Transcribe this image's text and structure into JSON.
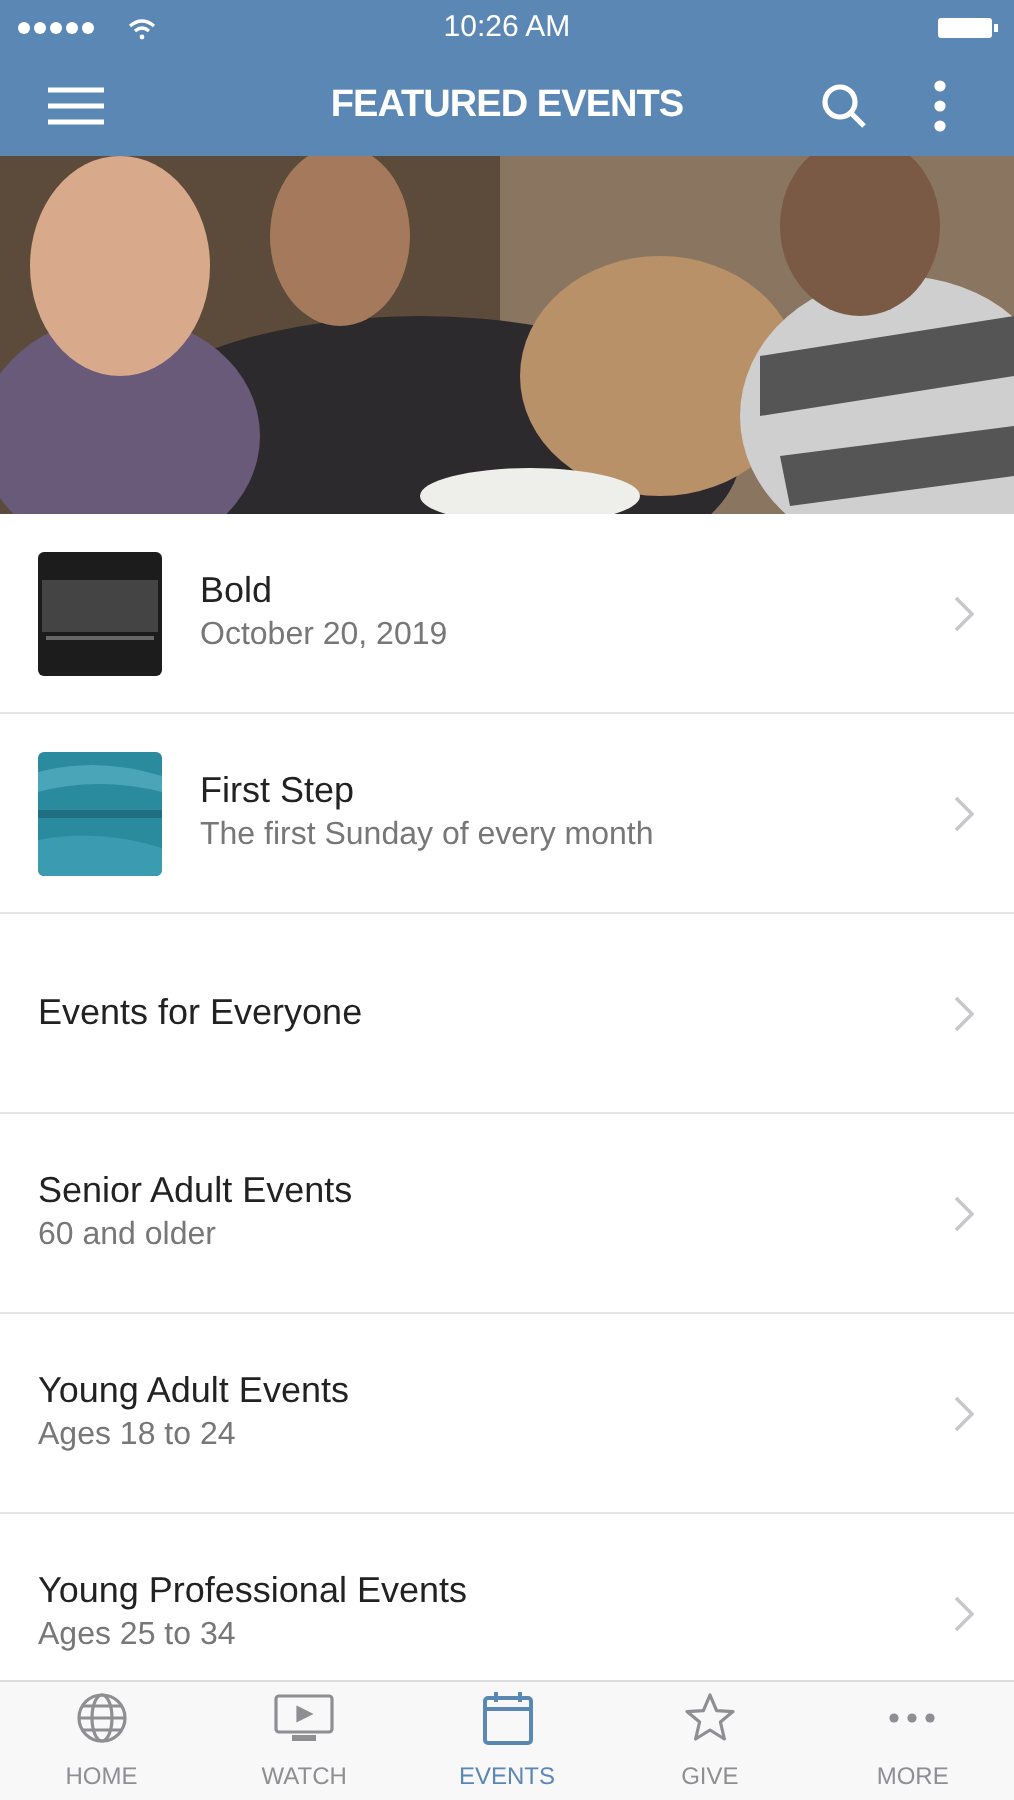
{
  "status_bar": {
    "time": "10:26 AM"
  },
  "nav_bar": {
    "title": "FEATURED EVENTS"
  },
  "events": [
    {
      "kind": "thumb",
      "title": "Bold",
      "subtitle": "October 20, 2019"
    },
    {
      "kind": "thumb",
      "title": "First Step",
      "subtitle": "The first Sunday of every month"
    },
    {
      "kind": "text",
      "title": "Events for Everyone"
    },
    {
      "kind": "text",
      "title": "Senior Adult Events",
      "subtitle": "60 and older"
    },
    {
      "kind": "text",
      "title": "Young Adult Events",
      "subtitle": "Ages 18 to 24"
    },
    {
      "kind": "text",
      "title": "Young Professional Events",
      "subtitle": "Ages 25 to 34"
    }
  ],
  "tab_bar": [
    {
      "label": "HOME",
      "selected": false
    },
    {
      "label": "WATCH",
      "selected": false
    },
    {
      "label": "EVENTS",
      "selected": true
    },
    {
      "label": "GIVE",
      "selected": false
    },
    {
      "label": "MORE",
      "selected": false
    }
  ]
}
